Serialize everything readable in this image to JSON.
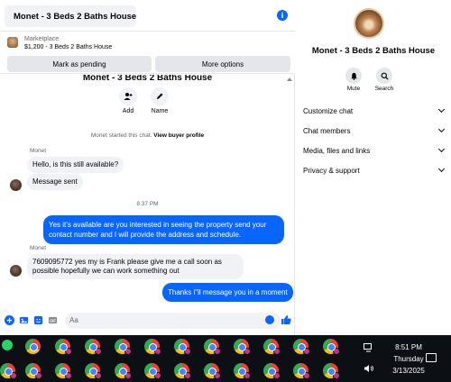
{
  "header": {
    "title": "Monet - 3 Beds 2 Baths House",
    "info_icon": "info-icon"
  },
  "listing": {
    "category": "Marketplace",
    "price_title": "$1,200 - 3 Beds 2 Baths House",
    "pending_label": "Mark as pending",
    "more_label": "More options"
  },
  "profile": {
    "name": "Monet - 3 Beds 2 Baths House",
    "add_label": "Add",
    "name_label": "Name"
  },
  "conversation": {
    "started_prefix": "Monet started this chat.",
    "started_link": "View buyer profile",
    "sender1": "Monet",
    "msg1": "Hello, is this still available?",
    "msg2": "Message sent",
    "time": "8:37 PM",
    "out1": "Yes it's available are you interested in seeing the property send your contact number and I will provide the address and schedule.",
    "sender2": "Monet",
    "msg3": "7609095772 yes my is Frank please give me a call soon as possible hopefully we can work something out",
    "out2": "Thanks i\"ll message you in a moment"
  },
  "composer": {
    "placeholder": "Aa"
  },
  "side": {
    "name": "Monet - 3 Beds 2 Baths House",
    "mute_label": "Mute",
    "search_label": "Search",
    "items": [
      {
        "label": "Customize chat"
      },
      {
        "label": "Chat members"
      },
      {
        "label": "Media, files and links"
      },
      {
        "label": "Privacy & support"
      }
    ]
  },
  "tray": {
    "time": "8:51 PM",
    "day": "Thursday",
    "date": "3/13/2025"
  },
  "colors": {
    "accent": "#0866ff",
    "bubble_in": "#f0f2f5",
    "taskbar": "#0c0f14"
  }
}
